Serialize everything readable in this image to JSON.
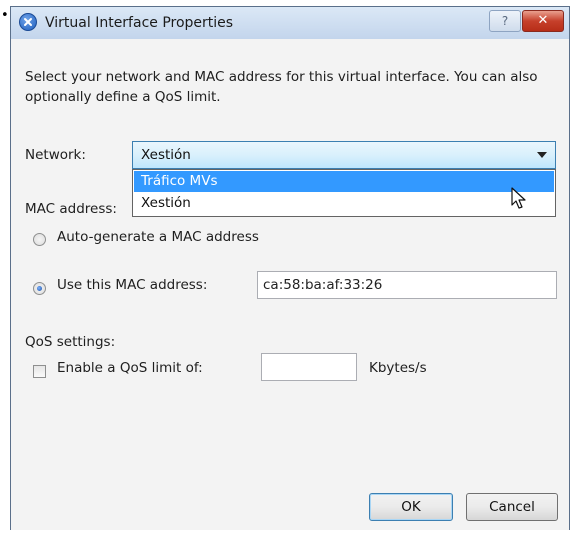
{
  "window": {
    "title": "Virtual Interface Properties",
    "close_glyph": "✕",
    "help_glyph": "?"
  },
  "description": "Select your network and MAC address for this virtual interface. You can also optionally define a QoS limit.",
  "network": {
    "label": "Network:",
    "selected": "Xestión",
    "options": [
      "Tráfico MVs",
      "Xestión"
    ],
    "highlighted": "Tráfico MVs"
  },
  "mac": {
    "section_label": "MAC address:",
    "auto_label": "Auto-generate a MAC address",
    "use_label": "Use this MAC address:",
    "value": "ca:58:ba:af:33:26",
    "auto_selected": false,
    "use_selected": true
  },
  "qos": {
    "section_label": "QoS settings:",
    "enable_label": "Enable a QoS limit of:",
    "limit_value": "",
    "unit": "Kbytes/s",
    "enabled": false
  },
  "buttons": {
    "ok": "OK",
    "cancel": "Cancel"
  },
  "icons": {
    "title": "x-circle-icon",
    "help": "help-icon",
    "close": "close-icon",
    "dropdown": "chevron-down-icon",
    "cursor": "mouse-pointer-icon"
  },
  "colors": {
    "selection": "#3399ff",
    "close_button": "#c6402b",
    "combo_border": "#3c7fb1"
  }
}
